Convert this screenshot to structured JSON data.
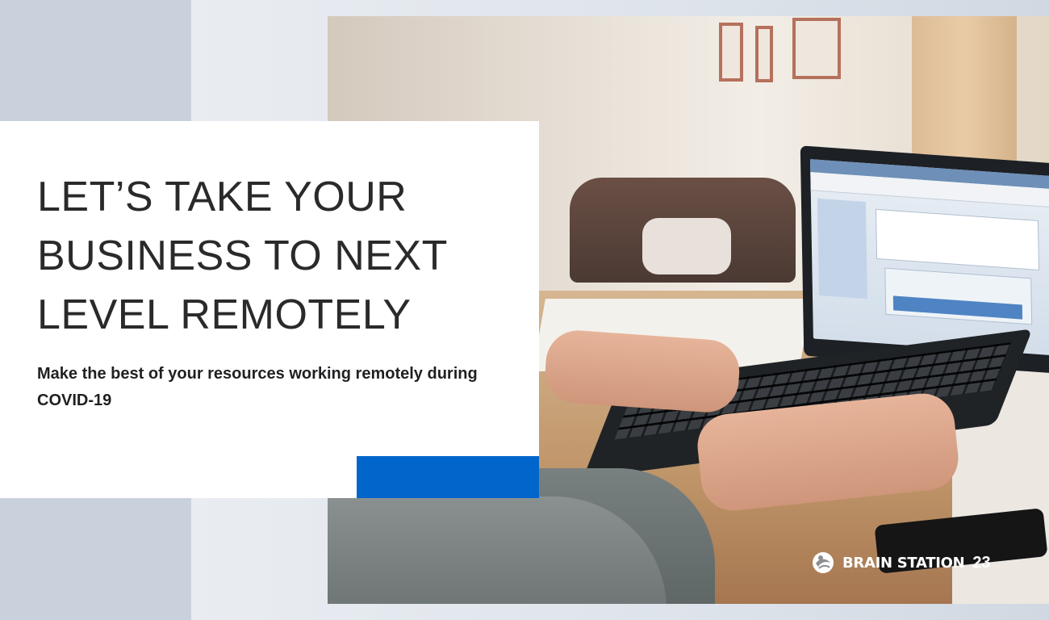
{
  "hero": {
    "headline": "LET’S TAKE YOUR BUSINESS TO NEXT LEVEL REMOTELY",
    "subline": "Make the best of your resources working remotely during COVID-19"
  },
  "brand": {
    "name": "BRAIN STATION",
    "number": "23",
    "icon": "brain-station-logo-icon"
  },
  "colors": {
    "accent": "#0066cc",
    "card": "#ffffff",
    "headline": "#2a2a2a"
  },
  "photo": {
    "icon": "laptop-remote-work-photo"
  }
}
